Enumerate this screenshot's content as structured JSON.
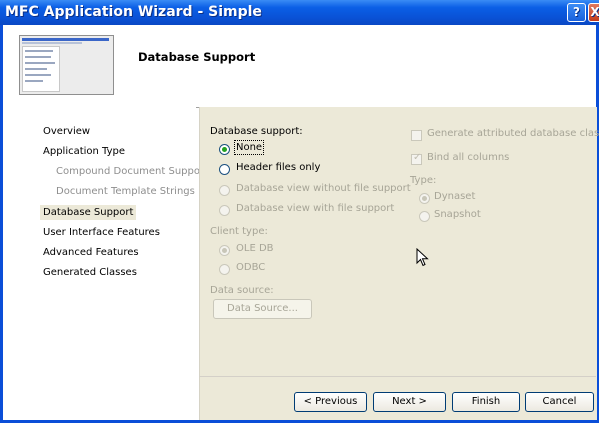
{
  "window": {
    "title": "MFC Application Wizard - Simple",
    "help_label": "?",
    "close_label": "X"
  },
  "header": {
    "page_title": "Database Support"
  },
  "sidebar": {
    "items": [
      {
        "label": "Overview",
        "sub": false,
        "selected": false
      },
      {
        "label": "Application Type",
        "sub": false,
        "selected": false
      },
      {
        "label": "Compound Document Support",
        "sub": true,
        "selected": false
      },
      {
        "label": "Document Template Strings",
        "sub": true,
        "selected": false
      },
      {
        "label": "Database Support",
        "sub": false,
        "selected": true
      },
      {
        "label": "User Interface Features",
        "sub": false,
        "selected": false
      },
      {
        "label": "Advanced Features",
        "sub": false,
        "selected": false
      },
      {
        "label": "Generated Classes",
        "sub": false,
        "selected": false
      }
    ]
  },
  "main": {
    "database_support_label": "Database support:",
    "db_options": [
      {
        "label": "None",
        "checked": true,
        "enabled": true
      },
      {
        "label": "Header files only",
        "checked": false,
        "enabled": true
      },
      {
        "label": "Database view without file support",
        "checked": false,
        "enabled": false
      },
      {
        "label": "Database view with file support",
        "checked": false,
        "enabled": false
      }
    ],
    "client_type_label": "Client type:",
    "client_options": [
      {
        "label": "OLE DB",
        "checked": true
      },
      {
        "label": "ODBC",
        "checked": false
      }
    ],
    "data_source_label": "Data source:",
    "data_source_button": "Data Source...",
    "generate_attributed_label": "Generate attributed database class",
    "bind_all_columns_label": "Bind all columns",
    "type_label": "Type:",
    "type_options": [
      {
        "label": "Dynaset",
        "checked": true
      },
      {
        "label": "Snapshot",
        "checked": false
      }
    ]
  },
  "footer": {
    "previous_label": "< Previous",
    "next_label": "Next >",
    "finish_label": "Finish",
    "cancel_label": "Cancel"
  }
}
